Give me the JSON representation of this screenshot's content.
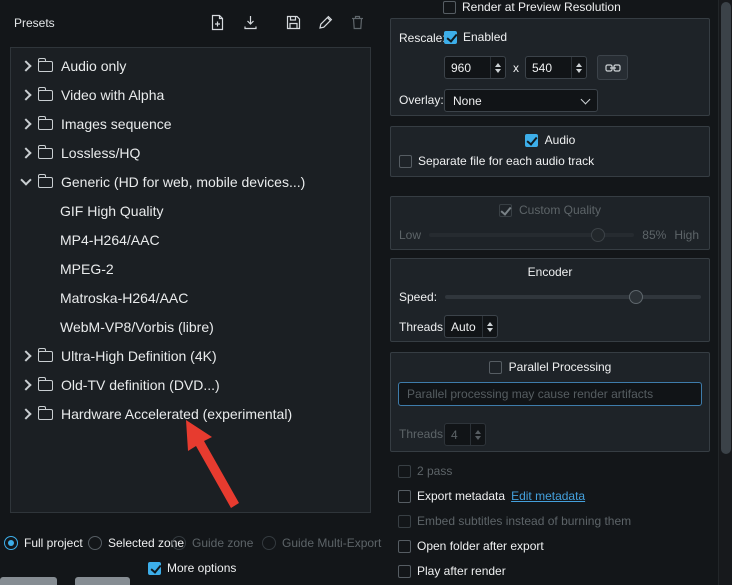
{
  "colors": {
    "accent": "#3daee9",
    "window_bg": "#131619",
    "groupbox_bg": "#1e2328",
    "tree_bg": "#1b1f23",
    "text": "#eff0f1",
    "disabled_text": "#5d6468",
    "link": "#44a0dc",
    "annotation_arrow_red": "#e73b2f"
  },
  "presets": {
    "title": "Presets",
    "toolbar_icons": [
      "new-preset-icon",
      "download-preset-icon",
      "save-preset-icon",
      "edit-preset-icon",
      "delete-preset-icon"
    ],
    "tree": [
      {
        "label": "Audio only"
      },
      {
        "label": "Video with Alpha"
      },
      {
        "label": "Images sequence"
      },
      {
        "label": "Lossless/HQ"
      },
      {
        "label": "Generic (HD for web, mobile devices...)"
      },
      {
        "label": "GIF High Quality"
      },
      {
        "label": "MP4-H264/AAC"
      },
      {
        "label": "MPEG-2"
      },
      {
        "label": "Matroska-H264/AAC"
      },
      {
        "label": "WebM-VP8/Vorbis (libre)"
      },
      {
        "label": "Ultra-High Definition (4K)"
      },
      {
        "label": "Old-TV definition (DVD...)"
      },
      {
        "label": "Hardware Accelerated (experimental)"
      }
    ],
    "zone": {
      "full_project": "Full project",
      "selected_zone": "Selected zone",
      "guide_zone": "Guide zone",
      "guide_multi_export": "Guide Multi-Export"
    },
    "more_options": "More options"
  },
  "options": {
    "render_preview": "Render at Preview Resolution",
    "rescale_label": "Rescale:",
    "rescale_enabled": "Enabled",
    "rescale_width": "960",
    "rescale_x": "x",
    "rescale_height": "540",
    "overlay_label": "Overlay:",
    "overlay_value": "None",
    "audio": "Audio",
    "separate_audio": "Separate file for each audio track",
    "custom_quality": "Custom Quality",
    "quality_low": "Low",
    "quality_value": "85%",
    "quality_high": "High",
    "encoder": "Encoder",
    "speed_label": "Speed:",
    "threads_label": "Threads:",
    "threads_value": "Auto",
    "parallel": "Parallel Processing",
    "parallel_warning": "Parallel processing may cause render artifacts",
    "parallel_threads_label": "Threads:",
    "parallel_threads_value": "4",
    "two_pass": "2 pass",
    "export_metadata": "Export metadata",
    "edit_metadata": "Edit metadata",
    "embed_subtitles": "Embed subtitles instead of burning them",
    "open_folder": "Open folder after export",
    "play_after": "Play after render"
  }
}
